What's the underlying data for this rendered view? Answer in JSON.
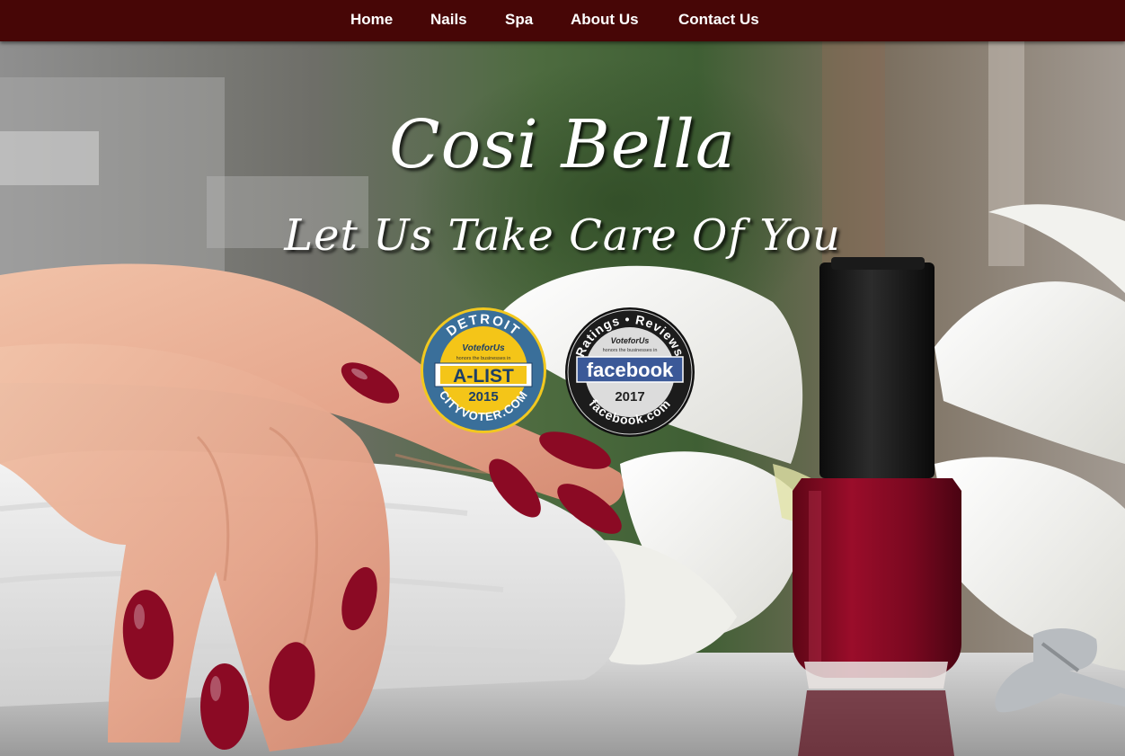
{
  "nav": {
    "items": [
      {
        "label": "Home"
      },
      {
        "label": "Nails"
      },
      {
        "label": "Spa"
      },
      {
        "label": "About Us"
      },
      {
        "label": "Contact Us"
      }
    ]
  },
  "hero": {
    "title": "Cosi Bella",
    "tagline": "Let Us Take Care Of You",
    "image": "nail-salon-hero-photo"
  },
  "badges": {
    "alist": {
      "top_text": "DETROIT",
      "brand": "VoteforUs",
      "subtext": "honors the businesses in",
      "main": "A-LIST",
      "year": "2015",
      "bottom_text": "CITYVOTER.COM"
    },
    "facebook": {
      "top_text": "Ratings • Reviews",
      "brand": "VoteforUs",
      "subtext": "honors the businesses in",
      "main": "facebook",
      "year": "2017",
      "bottom_text": "facebook.com"
    }
  },
  "colors": {
    "nav_bg": "#470606",
    "nail_polish": "#8b0a24",
    "badge_gold": "#f4c518",
    "badge_blue": "#3a6f9a",
    "facebook_blue": "#3b5998"
  }
}
